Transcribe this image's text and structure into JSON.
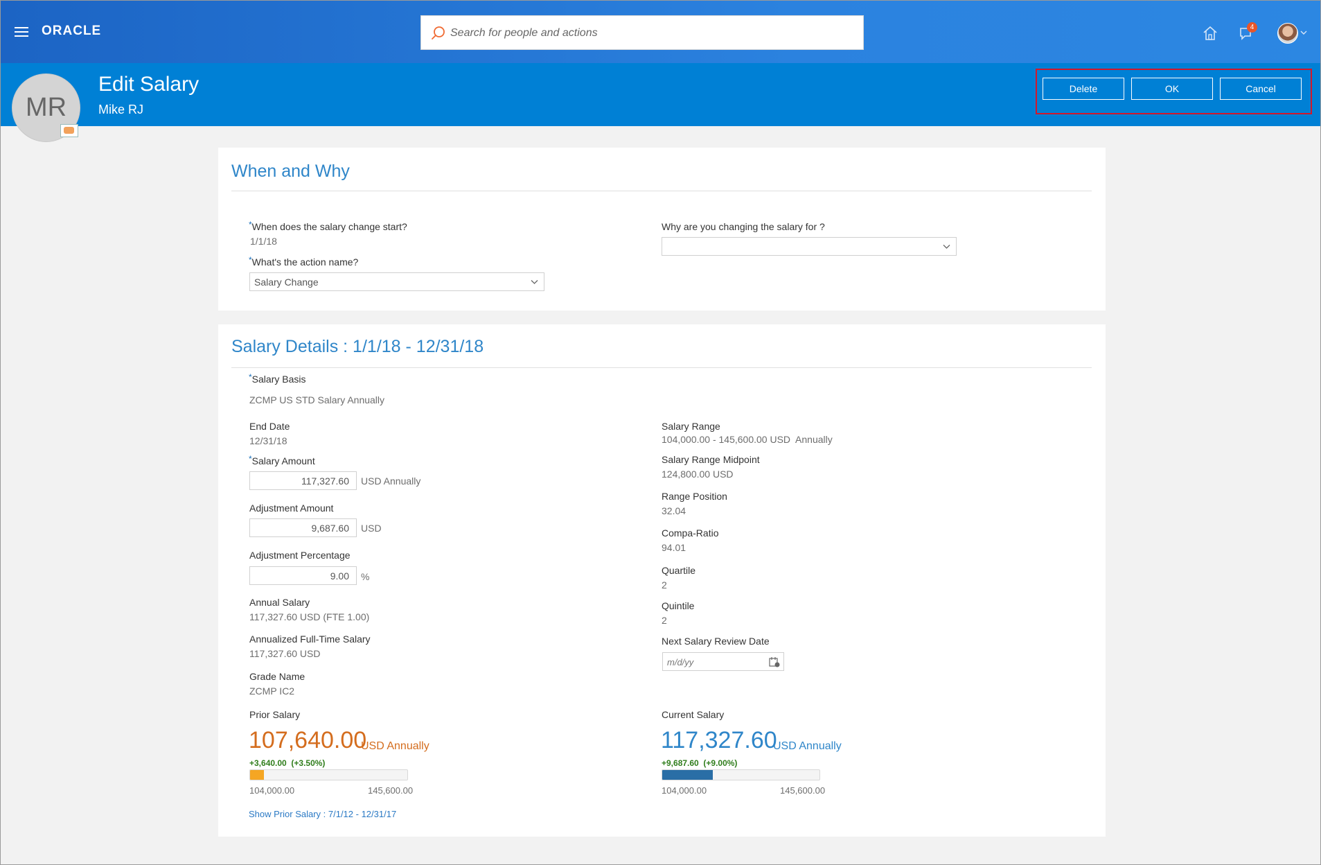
{
  "app": {
    "logo": "ORACLE",
    "search_placeholder": "Search for people and actions",
    "notification_count": "4"
  },
  "header": {
    "avatar_initials": "MR",
    "title": "Edit Salary",
    "subtitle": "Mike RJ",
    "buttons": {
      "delete": "Delete",
      "ok": "OK",
      "cancel": "Cancel"
    }
  },
  "when_why": {
    "title": "When and Why",
    "start_label": "When does the salary change start?",
    "start_value": "1/1/18",
    "action_label": "What's the action name?",
    "action_value": "Salary Change",
    "reason_label": "Why are you changing the salary for ?",
    "reason_value": ""
  },
  "details": {
    "title": "Salary Details : 1/1/18 - 12/31/18",
    "salary_basis_label": "Salary Basis",
    "salary_basis_value": "ZCMP US STD Salary Annually",
    "end_date_label": "End Date",
    "end_date_value": "12/31/18",
    "salary_amount_label": "Salary Amount",
    "salary_amount_value": "117,327.60",
    "salary_amount_unit": "USD Annually",
    "adjustment_amount_label": "Adjustment Amount",
    "adjustment_amount_value": "9,687.60",
    "adjustment_amount_unit": "USD",
    "adjustment_pct_label": "Adjustment Percentage",
    "adjustment_pct_value": "9.00",
    "adjustment_pct_unit": "%",
    "annual_salary_label": "Annual Salary",
    "annual_salary_value": "117,327.60 USD (FTE 1.00)",
    "annualized_label": "Annualized Full-Time Salary",
    "annualized_value": "117,327.60 USD",
    "grade_label": "Grade Name",
    "grade_value": "ZCMP IC2",
    "salary_range_label": "Salary Range",
    "salary_range_value": "104,000.00 - 145,600.00 USD  Annually",
    "midpoint_label": "Salary Range Midpoint",
    "midpoint_value": "124,800.00 USD",
    "range_position_label": "Range Position",
    "range_position_value": "32.04",
    "compa_label": "Compa-Ratio",
    "compa_value": "94.01",
    "quartile_label": "Quartile",
    "quartile_value": "2",
    "quintile_label": "Quintile",
    "quintile_value": "2",
    "review_date_label": "Next Salary Review Date",
    "review_date_placeholder": "m/d/yy",
    "prior": {
      "label": "Prior Salary",
      "amount": "107,640.00",
      "unit": "USD Annually",
      "delta": "+3,640.00  (+3.50%)",
      "bar_min": "104,000.00",
      "bar_max": "145,600.00",
      "fill_fraction": 0.0875,
      "fill_color": "#f5a623"
    },
    "current": {
      "label": "Current Salary",
      "amount": "117,327.60",
      "unit": "USD Annually",
      "delta": "+9,687.60  (+9.00%)",
      "bar_min": "104,000.00",
      "bar_max": "145,600.00",
      "fill_fraction": 0.3204,
      "fill_color": "#2a6ea6"
    },
    "show_prior_link": "Show Prior Salary : 7/1/12 - 12/31/17"
  }
}
